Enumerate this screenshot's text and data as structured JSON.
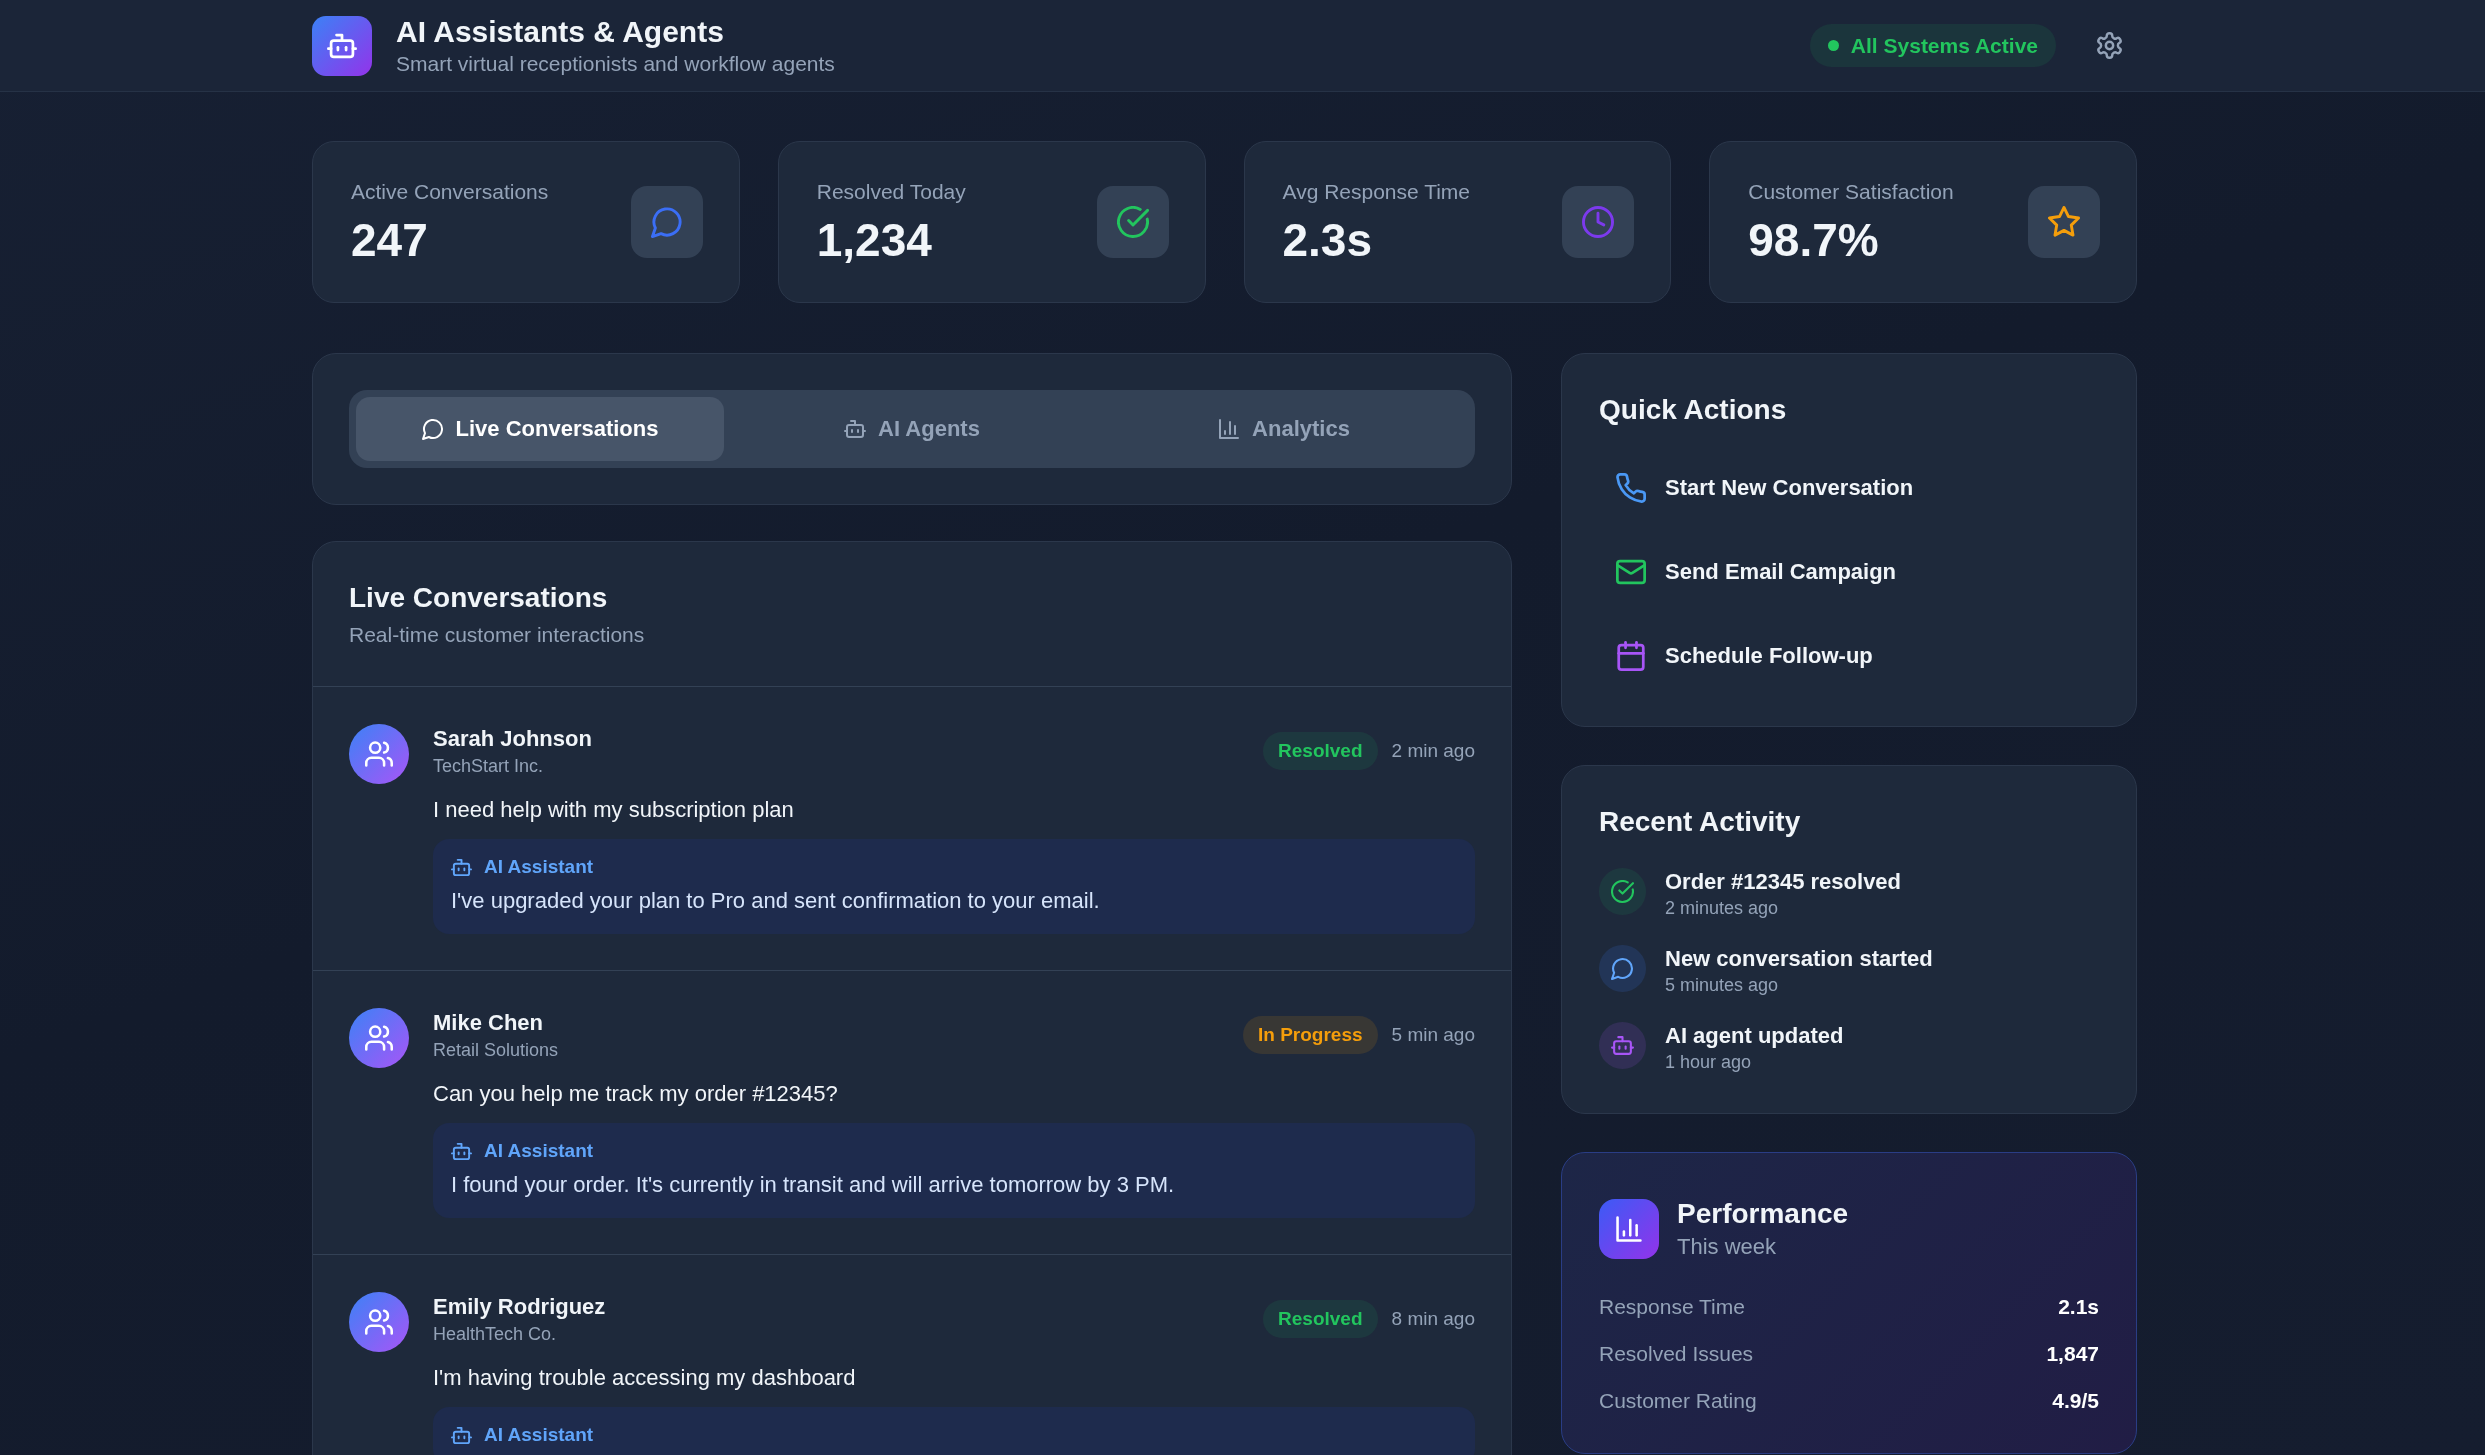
{
  "header": {
    "title": "AI Assistants & Agents",
    "subtitle": "Smart virtual receptionists and workflow agents",
    "status": {
      "label": "All Systems Active",
      "kind": "active"
    }
  },
  "stats": [
    {
      "label": "Active Conversations",
      "value": "247",
      "kind": "chat"
    },
    {
      "label": "Resolved Today",
      "value": "1,234",
      "kind": "check"
    },
    {
      "label": "Avg Response Time",
      "value": "2.3s",
      "kind": "clock"
    },
    {
      "label": "Customer Satisfaction",
      "value": "98.7%",
      "kind": "star"
    }
  ],
  "tabs": [
    {
      "label": "Live Conversations",
      "kind": "chat",
      "selected": true
    },
    {
      "label": "AI Agents",
      "kind": "robot",
      "selected": false
    },
    {
      "label": "Analytics",
      "kind": "chart",
      "selected": false
    }
  ],
  "conversations": {
    "title": "Live Conversations",
    "subtitle": "Real-time customer interactions",
    "items": [
      {
        "name": "Sarah Johnson",
        "company": "TechStart Inc.",
        "status": {
          "label": "Resolved",
          "kind": "resolved"
        },
        "time": "2 min ago",
        "message": "I need help with my subscription plan",
        "reply": {
          "label": "AI Assistant",
          "text": "I've upgraded your plan to Pro and sent confirmation to your email."
        }
      },
      {
        "name": "Mike Chen",
        "company": "Retail Solutions",
        "status": {
          "label": "In Progress",
          "kind": "in_progress"
        },
        "time": "5 min ago",
        "message": "Can you help me track my order #12345?",
        "reply": {
          "label": "AI Assistant",
          "text": "I found your order. It's currently in transit and will arrive tomorrow by 3 PM."
        }
      },
      {
        "name": "Emily Rodriguez",
        "company": "HealthTech Co.",
        "status": {
          "label": "Resolved",
          "kind": "resolved"
        },
        "time": "8 min ago",
        "message": "I'm having trouble accessing my dashboard",
        "reply": {
          "label": "AI Assistant"
        }
      }
    ]
  },
  "quick_actions": {
    "title": "Quick Actions",
    "items": [
      {
        "label": "Start New Conversation",
        "kind": "phone"
      },
      {
        "label": "Send Email Campaign",
        "kind": "mail"
      },
      {
        "label": "Schedule Follow-up",
        "kind": "calendar"
      }
    ]
  },
  "recent_activity": {
    "title": "Recent Activity",
    "items": [
      {
        "text": "Order #12345 resolved",
        "time": "2 minutes ago",
        "kind": "check"
      },
      {
        "text": "New conversation started",
        "time": "5 minutes ago",
        "kind": "chat"
      },
      {
        "text": "AI agent updated",
        "time": "1 hour ago",
        "kind": "robot"
      }
    ]
  },
  "performance": {
    "title": "Performance",
    "subtitle": "This week",
    "rows": [
      {
        "label": "Response Time",
        "value": "2.1s"
      },
      {
        "label": "Resolved Issues",
        "value": "1,847"
      },
      {
        "label": "Customer Rating",
        "value": "4.9/5"
      }
    ]
  }
}
